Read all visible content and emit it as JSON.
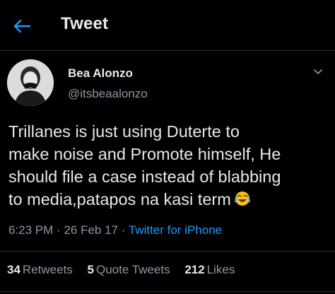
{
  "header": {
    "title": "Tweet",
    "back_icon": "arrow-left-icon"
  },
  "author": {
    "display_name": "Bea Alonzo",
    "handle": "@itsbeaalonzo",
    "avatar_icon": "avatar"
  },
  "tweet": {
    "lines": [
      "Trillanes is just using Duterte to",
      "make noise and Promote himself, He",
      "should file a case instead of blabbing",
      "to media,patapos na kasi term"
    ],
    "emoji": "face-with-tears-of-joy-icon"
  },
  "meta": {
    "time": "6:23 PM",
    "separator": "·",
    "date": "26 Feb 17",
    "source": "Twitter for iPhone"
  },
  "stats": {
    "retweets_count": "34",
    "retweets_label": "Retweets",
    "quotes_count": "5",
    "quotes_label": "Quote Tweets",
    "likes_count": "212",
    "likes_label": "Likes"
  },
  "colors": {
    "background": "#000000",
    "text": "#e7e9ea",
    "secondary": "#8b98a5",
    "accent": "#1d9bf0",
    "border": "#2f3336"
  }
}
